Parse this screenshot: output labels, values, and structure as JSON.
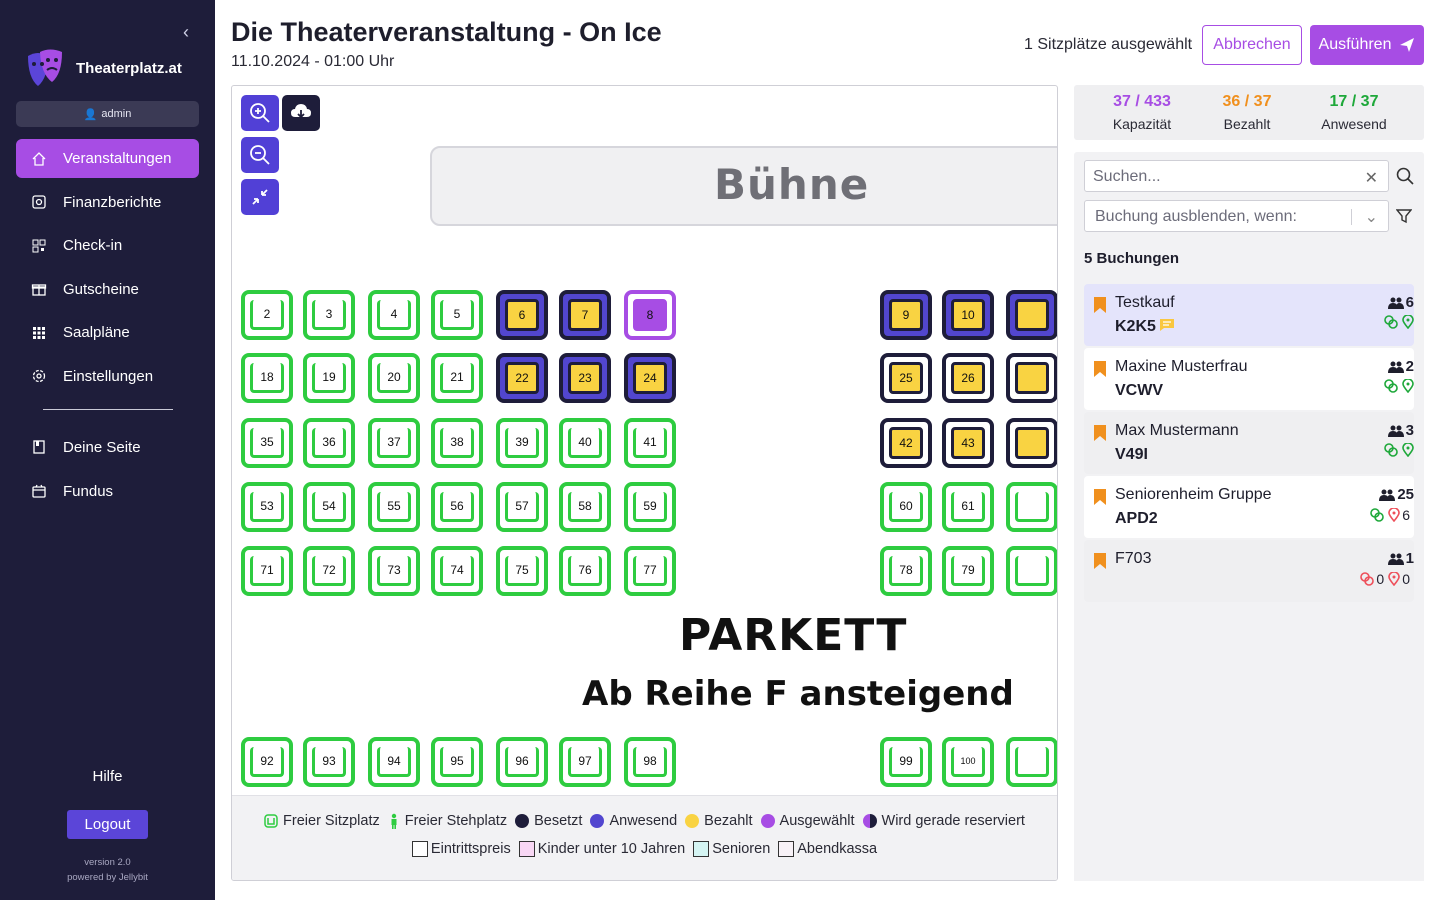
{
  "sidebar": {
    "brand": "Theaterplatz.at",
    "user": "admin",
    "nav": [
      {
        "label": "Veranstaltungen",
        "icon": "home-icon",
        "active": true
      },
      {
        "label": "Finanzberichte",
        "icon": "finance-icon"
      },
      {
        "label": "Check-in",
        "icon": "qr-icon"
      },
      {
        "label": "Gutscheine",
        "icon": "gift-icon"
      },
      {
        "label": "Saalpläne",
        "icon": "grid-icon"
      }
    ],
    "settings": "Einstellungen",
    "nav2": [
      {
        "label": "Deine Seite",
        "icon": "book-icon"
      },
      {
        "label": "Fundus",
        "icon": "box-icon"
      }
    ],
    "help": "Hilfe",
    "logout": "Logout",
    "version": "version 2.0",
    "powered": "powered by Jellybit"
  },
  "header": {
    "title": "Die Theaterveranstaltung - On Ice",
    "date": "11.10.2024 - 01:00 Uhr",
    "selected_text": "1 Sitzplätze ausgewählt",
    "cancel": "Abbrechen",
    "run": "Ausführen"
  },
  "plan": {
    "stage": "Bühne",
    "section": "PARKETT",
    "section_sub": "Ab Reihe F ansteigend",
    "rows": [
      {
        "seats": [
          [
            "2",
            "free"
          ],
          [
            "3",
            "free"
          ],
          [
            "4",
            "free"
          ],
          [
            "5",
            "free"
          ],
          [
            "6",
            "paid"
          ],
          [
            "7",
            "paid"
          ],
          [
            "8",
            "selected"
          ],
          [
            "9",
            "paid"
          ],
          [
            "10",
            "paid"
          ],
          [
            "",
            "paid"
          ]
        ]
      },
      {
        "seats": [
          [
            "18",
            "free"
          ],
          [
            "19",
            "free"
          ],
          [
            "20",
            "free"
          ],
          [
            "21",
            "free"
          ],
          [
            "22",
            "paid"
          ],
          [
            "23",
            "paid"
          ],
          [
            "24",
            "paid"
          ],
          [
            "25",
            "paidonly"
          ],
          [
            "26",
            "paidonly"
          ],
          [
            "",
            "paidonly"
          ]
        ]
      },
      {
        "seats": [
          [
            "35",
            "free"
          ],
          [
            "36",
            "free"
          ],
          [
            "37",
            "free"
          ],
          [
            "38",
            "free"
          ],
          [
            "39",
            "free"
          ],
          [
            "40",
            "free"
          ],
          [
            "41",
            "free"
          ],
          [
            "42",
            "paidonly"
          ],
          [
            "43",
            "paidonly"
          ],
          [
            "",
            "paidonly"
          ]
        ]
      },
      {
        "seats": [
          [
            "53",
            "free"
          ],
          [
            "54",
            "free"
          ],
          [
            "55",
            "free"
          ],
          [
            "56",
            "free"
          ],
          [
            "57",
            "free"
          ],
          [
            "58",
            "free"
          ],
          [
            "59",
            "free"
          ],
          [
            "60",
            "free"
          ],
          [
            "61",
            "free"
          ],
          [
            "",
            "free"
          ]
        ]
      },
      {
        "seats": [
          [
            "71",
            "free"
          ],
          [
            "72",
            "free"
          ],
          [
            "73",
            "free"
          ],
          [
            "74",
            "free"
          ],
          [
            "75",
            "free"
          ],
          [
            "76",
            "free"
          ],
          [
            "77",
            "free"
          ],
          [
            "78",
            "free"
          ],
          [
            "79",
            "free"
          ],
          [
            "",
            "free"
          ]
        ]
      },
      {
        "seats": [
          [
            "92",
            "free"
          ],
          [
            "93",
            "free"
          ],
          [
            "94",
            "free"
          ],
          [
            "95",
            "free"
          ],
          [
            "96",
            "free"
          ],
          [
            "97",
            "free"
          ],
          [
            "98",
            "free"
          ],
          [
            "99",
            "free"
          ],
          [
            "100",
            "free"
          ],
          [
            "",
            "free"
          ]
        ]
      }
    ],
    "legend_row1": [
      {
        "label": "Freier Sitzplatz",
        "icon": "seat-icon"
      },
      {
        "label": "Freier Stehplatz",
        "icon": "person-icon"
      },
      {
        "label": "Besetzt",
        "color": "#1e1d3a"
      },
      {
        "label": "Anwesend",
        "color": "#5246cf"
      },
      {
        "label": "Bezahlt",
        "color": "#f9d342"
      },
      {
        "label": "Ausgewählt",
        "color": "#a74de4"
      },
      {
        "label": "Wird gerade reserviert",
        "color": "half"
      }
    ],
    "legend_row2": [
      {
        "label": "Eintrittspreis",
        "color": "#ffffff"
      },
      {
        "label": "Kinder unter 10 Jahren",
        "color": "#f8d7f4"
      },
      {
        "label": "Senioren",
        "color": "#d5f5f3"
      },
      {
        "label": "Abendkassa",
        "color": "#f8f2f7"
      }
    ]
  },
  "stats": [
    {
      "value": "37 / 433",
      "label": "Kapazität",
      "color": "#a74de4"
    },
    {
      "value": "36 / 37",
      "label": "Bezahlt",
      "color": "#f0901e"
    },
    {
      "value": "17 / 37",
      "label": "Anwesend",
      "color": "#1ea83a"
    }
  ],
  "search": {
    "placeholder": "Suchen...",
    "filter_placeholder": "Buchung ausblenden, wenn:"
  },
  "bookings_title": "5 Buchungen",
  "bookings": [
    {
      "name": "Testkauf",
      "code": "K2K5",
      "count": "6",
      "paid": "",
      "present": "",
      "bg": "#e4e4fb",
      "note": true
    },
    {
      "name": "Maxine Musterfrau",
      "code": "VCWV",
      "count": "2",
      "paid": "",
      "present": "",
      "bg": "#ffffff"
    },
    {
      "name": "Max Mustermann",
      "code": "V49I",
      "count": "3",
      "paid": "",
      "present": "",
      "bg": "#efeff1"
    },
    {
      "name": "Seniorenheim Gruppe",
      "code": "APD2",
      "count": "25",
      "paid": "",
      "present": "6",
      "bg": "#ffffff",
      "present_red": true
    },
    {
      "name": "F703",
      "code": "",
      "count": "1",
      "paid": "0",
      "present": "0",
      "bg": "#efeff1",
      "both_red": true
    }
  ]
}
